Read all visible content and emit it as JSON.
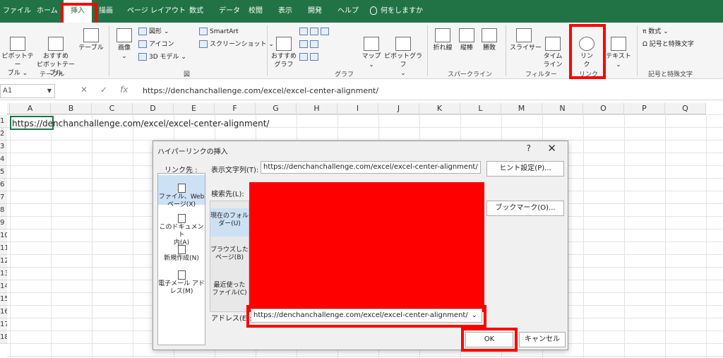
{
  "tabs": [
    "ファイル",
    "ホーム",
    "挿入",
    "描画",
    "ページ レイアウト",
    "数式",
    "データ",
    "校閲",
    "表示",
    "開発",
    "ヘルプ",
    "何をしますか"
  ],
  "ribbon": {
    "table_group": {
      "pivot": "ピボットテー\nブル ⌄",
      "recommended_pivot": "おすすめ\nピボットテーブル",
      "table": "テーブル",
      "label": "テーブル"
    },
    "illustrations": {
      "image": "画像",
      "image_arrow": "⌄",
      "shapes": "図形 ⌄",
      "icons": "アイコン",
      "model3d": "3D モデル  ⌄",
      "smartart": "SmartArt",
      "screenshot": "スクリーンショット ⌄",
      "label": "図"
    },
    "charts": {
      "recommended": "おすすめ\nグラフ",
      "map": "マップ\n⌄",
      "pivot_chart": "ピボットグラフ\n⌄",
      "label": "グラフ"
    },
    "sparklines": {
      "line": "折れ線",
      "column": "縦棒",
      "winloss": "勝敗",
      "label": "スパークライン"
    },
    "filters": {
      "slicer": "スライサー",
      "timeline": "タイム\nライン",
      "label": "フィルター"
    },
    "links": {
      "link": "リン\nク",
      "label": "リンク"
    },
    "text": {
      "text": "テキスト\n⌄"
    },
    "symbols": {
      "equation": "π  数式  ⌄",
      "symbol": "Ω  記号と特殊文字",
      "label": "記号と特殊文字"
    }
  },
  "formula_bar": {
    "name_box": "A1",
    "cancel": "✕",
    "enter": "✓",
    "fx": "fx",
    "value": "https://denchanchallenge.com/excel/excel-center-alignment/"
  },
  "grid": {
    "columns": [
      "A",
      "B",
      "C",
      "D",
      "E",
      "F",
      "G",
      "H",
      "I",
      "J",
      "K",
      "L",
      "M",
      "N",
      "O",
      "P",
      "Q"
    ],
    "rows": [
      "1",
      "2",
      "3",
      "4",
      "5",
      "6",
      "7",
      "8",
      "9",
      "10",
      "11",
      "12",
      "13",
      "14",
      "15",
      "16",
      "17",
      "18"
    ],
    "a1_value": "https://denchanchallenge.com/excel/excel-center-alignment/"
  },
  "dialog": {
    "title": "ハイパーリンクの挿入",
    "help": "?",
    "close": "✕",
    "link_to_label": "リンク先 :",
    "link_items": [
      "ファイル、Web\nページ(X)",
      "このドキュメント\n内(A)",
      "新規作成(N)",
      "電子メール アド\nレス(M)"
    ],
    "display_text_label": "表示文字列(T):",
    "display_text_value": "https://denchanchallenge.com/excel/excel-center-alignment/",
    "screentip_button": "ヒント設定(P)...",
    "look_in_label": "検索先(L):",
    "look_items": [
      "現在のフォル\nダー(U)",
      "ブラウズした\nページ(B)",
      "最近使った\nファイル(C)"
    ],
    "bookmark_button": "ブックマーク(O)...",
    "address_label": "アドレス(E):",
    "address_value": "https://denchanchallenge.com/excel/excel-center-alignment/",
    "address_arrow": "⌄",
    "ok_button": "OK",
    "cancel_button": "キャンセル"
  },
  "colors": {
    "excel_green": "#217346",
    "highlight_red": "#ff0000",
    "selection_blue": "#cde1f5"
  }
}
